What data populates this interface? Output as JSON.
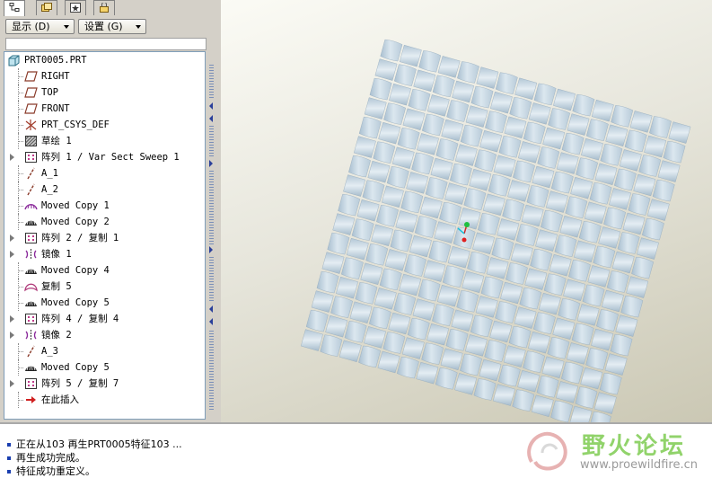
{
  "tabs": [
    {
      "icon": "model-tree-icon",
      "active": true
    },
    {
      "icon": "folder-browser-icon",
      "active": false
    },
    {
      "icon": "favorites-icon",
      "active": false
    },
    {
      "icon": "connections-icon",
      "active": false
    }
  ],
  "toolbar": {
    "show_label": "显示 (D)",
    "settings_label": "设置 (G)"
  },
  "tree": {
    "root": "PRT0005.PRT",
    "items": [
      {
        "label": "RIGHT",
        "icon": "datum-plane-icon",
        "expandable": false
      },
      {
        "label": "TOP",
        "icon": "datum-plane-icon",
        "expandable": false
      },
      {
        "label": "FRONT",
        "icon": "datum-plane-icon",
        "expandable": false
      },
      {
        "label": "PRT_CSYS_DEF",
        "icon": "csys-icon",
        "expandable": false
      },
      {
        "label": "草绘 1",
        "icon": "sketch-icon",
        "expandable": false
      },
      {
        "label": "阵列 1 / Var Sect Sweep 1",
        "icon": "pattern-icon",
        "expandable": true
      },
      {
        "label": "A_1",
        "icon": "axis-icon",
        "expandable": false
      },
      {
        "label": "A_2",
        "icon": "axis-icon",
        "expandable": false
      },
      {
        "label": "Moved Copy 1",
        "icon": "moved-copy-outline-icon",
        "expandable": false
      },
      {
        "label": "Moved Copy 2",
        "icon": "moved-copy-icon",
        "expandable": false
      },
      {
        "label": "阵列 2 / 复制 1",
        "icon": "pattern-icon",
        "expandable": true
      },
      {
        "label": "镜像 1",
        "icon": "mirror-icon",
        "expandable": true
      },
      {
        "label": "Moved Copy 4",
        "icon": "moved-copy-icon",
        "expandable": false
      },
      {
        "label": "复制 5",
        "icon": "copy-surface-icon",
        "expandable": false
      },
      {
        "label": "Moved Copy 5",
        "icon": "moved-copy-icon",
        "expandable": false
      },
      {
        "label": "阵列 4 / 复制 4",
        "icon": "pattern-icon",
        "expandable": true
      },
      {
        "label": "镜像 2",
        "icon": "mirror-icon",
        "expandable": true
      },
      {
        "label": "A_3",
        "icon": "axis-icon",
        "expandable": false
      },
      {
        "label": "Moved Copy 5",
        "icon": "moved-copy-icon",
        "expandable": false
      },
      {
        "label": "阵列 5 / 复制 7",
        "icon": "pattern-icon",
        "expandable": true
      },
      {
        "label": "在此插入",
        "icon": "insert-here-arrow-icon",
        "expandable": false
      }
    ]
  },
  "status": {
    "messages": [
      "正在从103 再生PRT0005特征103 ...",
      "再生成功完成。",
      "特征成功重定义。"
    ]
  },
  "watermark": {
    "title": "野火论坛",
    "url": "www.proewildfire.cn"
  },
  "colors": {
    "surface": "#c9d9e4",
    "surface_shadow": "#a7bccb",
    "viewport_bg": "#e7e6dc",
    "status_dot": "#1a3fb0",
    "watermark_green": "#91d36b"
  }
}
